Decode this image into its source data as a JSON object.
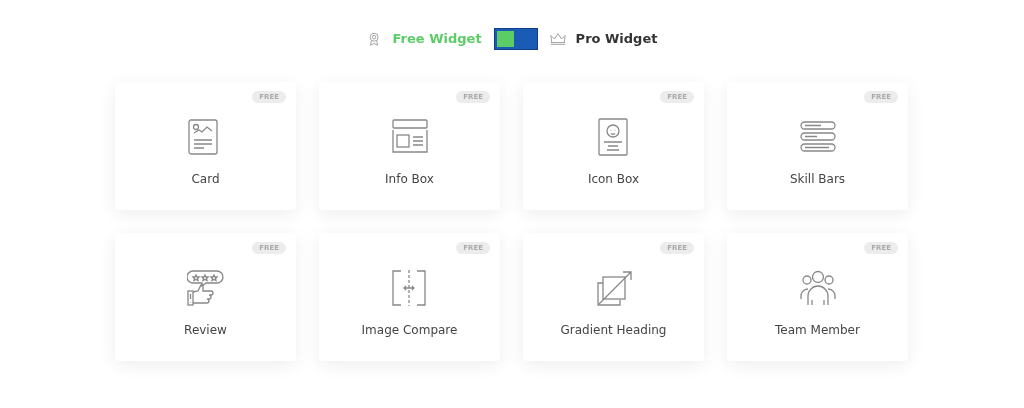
{
  "switcher": {
    "options": [
      {
        "kind": "free",
        "label": "Free Widget",
        "selected": true
      },
      {
        "kind": "pro",
        "label": "Pro Widget",
        "selected": false
      }
    ]
  },
  "widgets": [
    {
      "kind": "card",
      "name": "Card",
      "badge": "FREE"
    },
    {
      "kind": "info-box",
      "name": "Info Box",
      "badge": "FREE"
    },
    {
      "kind": "icon-box",
      "name": "Icon Box",
      "badge": "FREE"
    },
    {
      "kind": "skill-bars",
      "name": "Skill Bars",
      "badge": "FREE"
    },
    {
      "kind": "review",
      "name": "Review",
      "badge": "FREE"
    },
    {
      "kind": "image-compare",
      "name": "Image Compare",
      "badge": "FREE"
    },
    {
      "kind": "gradient-heading",
      "name": "Gradient Heading",
      "badge": "FREE"
    },
    {
      "kind": "team-member",
      "name": "Team Member",
      "badge": "FREE"
    }
  ]
}
